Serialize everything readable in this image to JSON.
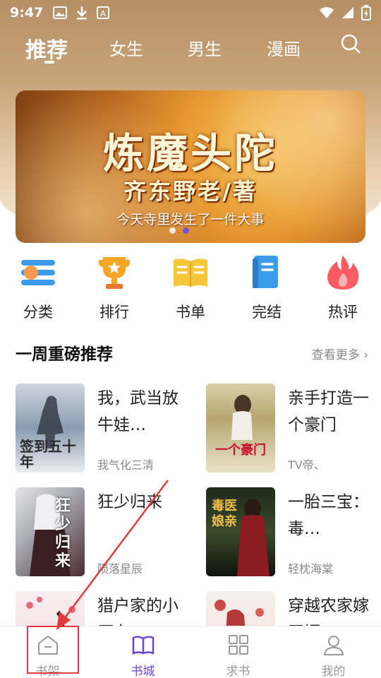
{
  "status_bar": {
    "time": "9:47"
  },
  "tabs": [
    {
      "label": "推荐",
      "active": true
    },
    {
      "label": "女生",
      "active": false
    },
    {
      "label": "男生",
      "active": false
    },
    {
      "label": "漫画",
      "active": false
    }
  ],
  "banner": {
    "title": "炼魔头陀",
    "author": "齐东野老/著",
    "subtitle": "今天寺里发生了一件大事",
    "page_count": 2,
    "active_page": 2
  },
  "categories": [
    {
      "label": "分类",
      "icon": "category-icon"
    },
    {
      "label": "排行",
      "icon": "trophy-icon"
    },
    {
      "label": "书单",
      "icon": "book-list-icon"
    },
    {
      "label": "完结",
      "icon": "finished-book-icon"
    },
    {
      "label": "热评",
      "icon": "flame-icon"
    }
  ],
  "section": {
    "title": "一周重磅推荐",
    "see_more": "查看更多"
  },
  "books": [
    {
      "title": "我，武当放牛娃…",
      "author": "我气化三清",
      "cover_text": "签到五十年"
    },
    {
      "title": "亲手打造一个豪门",
      "author": "TV帝、",
      "cover_text": "一个豪门"
    },
    {
      "title": "狂少归来",
      "author": "陨落星辰",
      "cover_text": "狂少归来"
    },
    {
      "title": "一胎三宝：毒…",
      "author": "轻枕海棠",
      "cover_text": "毒医娘亲"
    },
    {
      "title": "猎户家的小厨女",
      "author": "",
      "cover_text": ""
    },
    {
      "title": "穿越农家嫁恶婿",
      "author": "",
      "cover_text": ""
    }
  ],
  "bottom_nav": [
    {
      "label": "书架",
      "icon": "bookshelf-icon",
      "active": false
    },
    {
      "label": "书城",
      "icon": "bookstore-icon",
      "active": true
    },
    {
      "label": "求书",
      "icon": "request-book-icon",
      "active": false
    },
    {
      "label": "我的",
      "icon": "profile-icon",
      "active": false
    }
  ],
  "colors": {
    "accent": "#6a45d6",
    "highlight": "#e23b3b"
  }
}
